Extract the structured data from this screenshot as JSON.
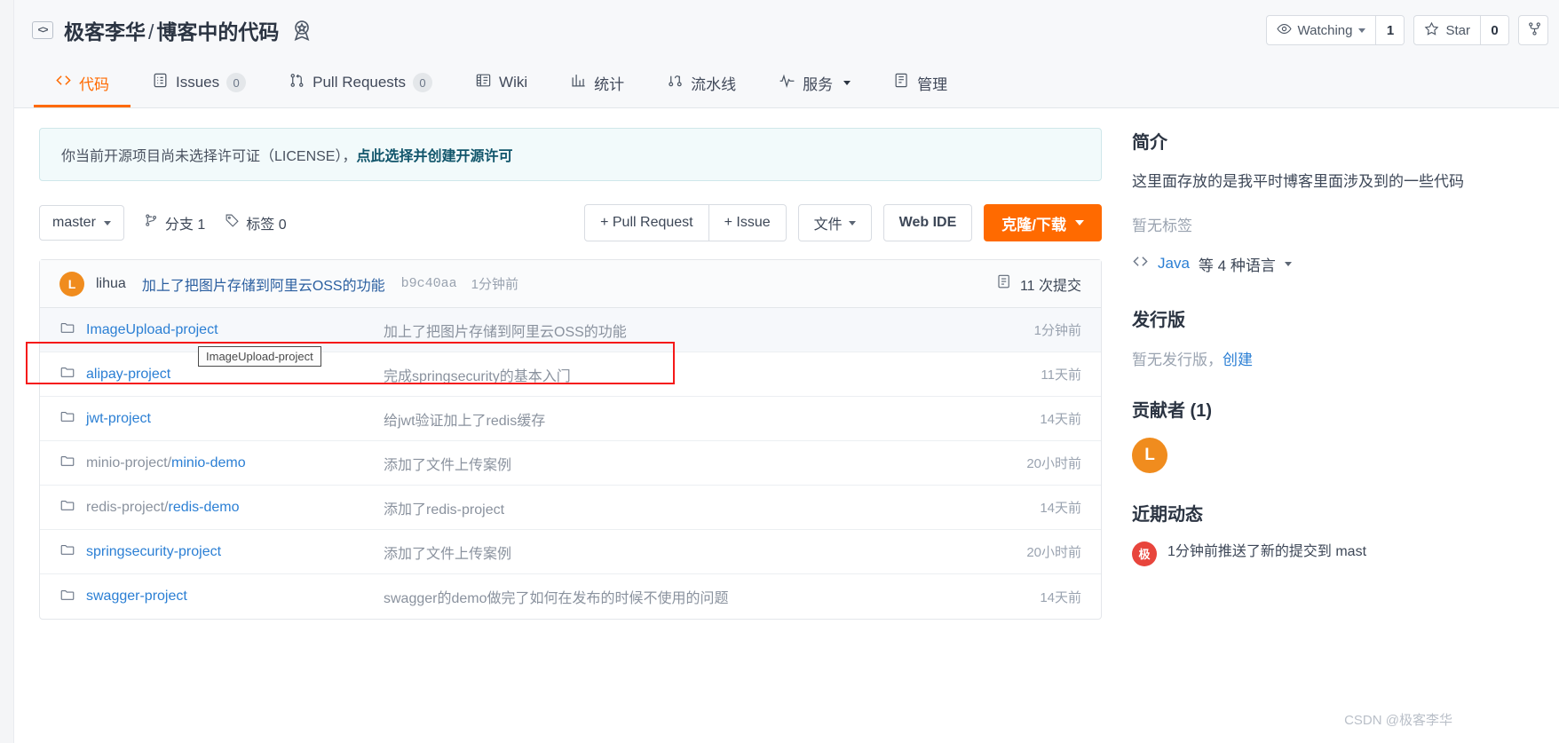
{
  "header": {
    "owner": "极客李华",
    "separator": "/",
    "repo": "博客中的代码",
    "repo_icon": "code-brackets-icon",
    "badge_icon": "award-badge-icon",
    "watching": {
      "label": "Watching",
      "count": "1",
      "icon": "eye-icon"
    },
    "star": {
      "label": "Star",
      "count": "0",
      "icon": "star-icon"
    },
    "fork": {
      "label": "",
      "count": "",
      "icon": "fork-icon"
    }
  },
  "nav": {
    "tabs": [
      {
        "label": "代码",
        "icon": "code-icon",
        "badge": "",
        "active": true
      },
      {
        "label": "Issues",
        "icon": "issue-list-icon",
        "badge": "0",
        "active": false
      },
      {
        "label": "Pull Requests",
        "icon": "pull-request-icon",
        "badge": "0",
        "active": false
      },
      {
        "label": "Wiki",
        "icon": "book-icon",
        "badge": "",
        "active": false
      },
      {
        "label": "统计",
        "icon": "chart-bar-icon",
        "badge": "",
        "active": false
      },
      {
        "label": "流水线",
        "icon": "pipeline-icon",
        "badge": "",
        "active": false
      },
      {
        "label": "服务",
        "icon": "pulse-icon",
        "badge": "",
        "active": false,
        "caret": true
      },
      {
        "label": "管理",
        "icon": "settings-doc-icon",
        "badge": "",
        "active": false
      }
    ]
  },
  "alert": {
    "text_before": "你当前开源项目尚未选择许可证（LICENSE），",
    "link_text": "点此选择并创建开源许可"
  },
  "toolbar": {
    "branch": "master",
    "branches_label": "分支 1",
    "tags_label": "标签 0",
    "pull_request_btn": "+ Pull Request",
    "issue_btn": "+ Issue",
    "files_btn": "文件",
    "web_ide_btn": "Web IDE",
    "clone_btn": "克隆/下载"
  },
  "commit": {
    "avatar_letter": "L",
    "author": "lihua",
    "message": "加上了把图片存储到阿里云OSS的功能",
    "sha": "b9c40aa",
    "time": "1分钟前",
    "count_label": "11 次提交",
    "count_icon": "commit-history-icon"
  },
  "files": [
    {
      "name": "ImageUpload-project",
      "prefix": "",
      "message": "加上了把图片存储到阿里云OSS的功能",
      "time": "1分钟前",
      "icon": "folder-icon",
      "highlighted": true
    },
    {
      "name": "alipay-project",
      "prefix": "",
      "message": "完成springsecurity的基本入门",
      "time": "11天前",
      "icon": "folder-icon",
      "highlighted": false
    },
    {
      "name": "jwt-project",
      "prefix": "",
      "message": "给jwt验证加上了redis缓存",
      "time": "14天前",
      "icon": "folder-icon",
      "highlighted": false
    },
    {
      "name": "minio-demo",
      "prefix": "minio-project/",
      "message": "添加了文件上传案例",
      "time": "20小时前",
      "icon": "folder-icon",
      "highlighted": false
    },
    {
      "name": "redis-demo",
      "prefix": "redis-project/",
      "message": "添加了redis-project",
      "time": "14天前",
      "icon": "folder-icon",
      "highlighted": false
    },
    {
      "name": "springsecurity-project",
      "prefix": "",
      "message": "添加了文件上传案例",
      "time": "20小时前",
      "icon": "folder-icon",
      "highlighted": false
    },
    {
      "name": "swagger-project",
      "prefix": "",
      "message": "swagger的demo做完了如何在发布的时候不使用的问题",
      "time": "14天前",
      "icon": "folder-icon",
      "highlighted": false
    }
  ],
  "tooltip": {
    "text": "ImageUpload-project"
  },
  "sidebar": {
    "intro_title": "简介",
    "intro_text": "这里面存放的是我平时博客里面涉及到的一些代码",
    "no_tags": "暂无标签",
    "language": "Java",
    "language_suffix": "等 4 种语言",
    "language_icon": "code-icon",
    "releases_title": "发行版",
    "releases_empty": "暂无发行版，",
    "releases_create": "创建",
    "contributors_title": "贡献者 (1)",
    "contributor_letter": "L",
    "activity_title": "近期动态",
    "activity_avatar_letter": "极",
    "activity_text": "1分钟前推送了新的提交到 mast"
  },
  "watermark": "CSDN @极客李华"
}
